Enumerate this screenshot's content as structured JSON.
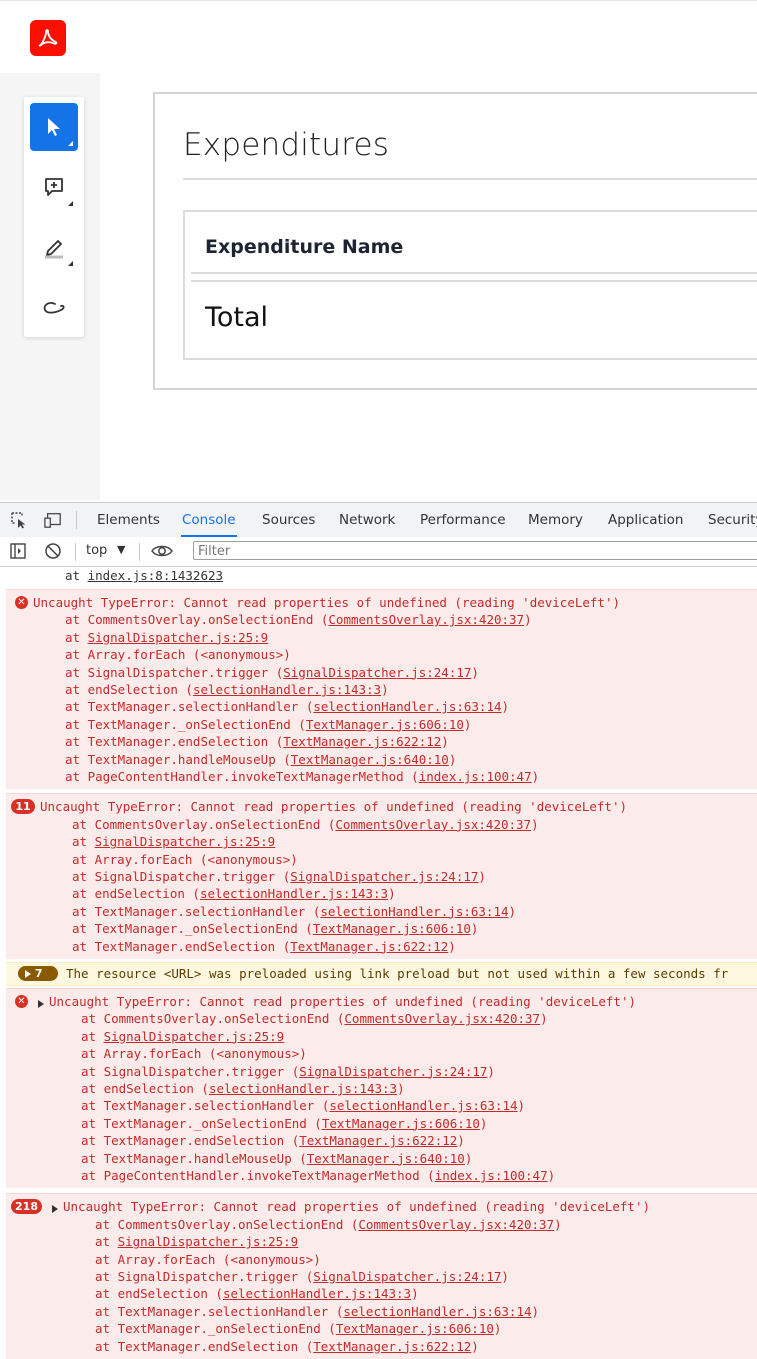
{
  "doc": {
    "title": "Expenditures",
    "table_header": "Expenditure Name",
    "row_total": "Total"
  },
  "devtools": {
    "tabs": [
      "Elements",
      "Console",
      "Sources",
      "Network",
      "Performance",
      "Memory",
      "Application",
      "Security"
    ],
    "active_tab": "Console",
    "context": "top",
    "filter_placeholder": "Filter"
  },
  "console": {
    "first_line": {
      "prefix": "at ",
      "link": "index.js:8:1432623"
    },
    "error_message": "Uncaught TypeError: Cannot read properties of undefined (reading 'deviceLeft')",
    "warning_count": "7",
    "warning_message": "The resource <URL> was preloaded using link preload but not used within a few seconds fr",
    "groups": [
      {
        "badge": "",
        "expandable": false,
        "stack": [
          {
            "fn": "CommentsOverlay.onSelectionEnd",
            "loc": "CommentsOverlay.jsx:420:37",
            "paren": true
          },
          {
            "fn": "",
            "loc": "SignalDispatcher.js:25:9",
            "paren": false
          },
          {
            "fn": "Array.forEach",
            "loc": "<anonymous>",
            "paren": true,
            "plain": true
          },
          {
            "fn": "SignalDispatcher.trigger",
            "loc": "SignalDispatcher.js:24:17",
            "paren": true
          },
          {
            "fn": "endSelection",
            "loc": "selectionHandler.js:143:3",
            "paren": true
          },
          {
            "fn": "TextManager.selectionHandler",
            "loc": "selectionHandler.js:63:14",
            "paren": true
          },
          {
            "fn": "TextManager._onSelectionEnd",
            "loc": "TextManager.js:606:10",
            "paren": true
          },
          {
            "fn": "TextManager.endSelection",
            "loc": "TextManager.js:622:12",
            "paren": true
          },
          {
            "fn": "TextManager.handleMouseUp",
            "loc": "TextManager.js:640:10",
            "paren": true
          },
          {
            "fn": "PageContentHandler.invokeTextManagerMethod",
            "loc": "index.js:100:47",
            "paren": true
          }
        ]
      },
      {
        "badge": "11",
        "expandable": false,
        "stack": [
          {
            "fn": "CommentsOverlay.onSelectionEnd",
            "loc": "CommentsOverlay.jsx:420:37",
            "paren": true
          },
          {
            "fn": "",
            "loc": "SignalDispatcher.js:25:9",
            "paren": false
          },
          {
            "fn": "Array.forEach",
            "loc": "<anonymous>",
            "paren": true,
            "plain": true
          },
          {
            "fn": "SignalDispatcher.trigger",
            "loc": "SignalDispatcher.js:24:17",
            "paren": true
          },
          {
            "fn": "endSelection",
            "loc": "selectionHandler.js:143:3",
            "paren": true
          },
          {
            "fn": "TextManager.selectionHandler",
            "loc": "selectionHandler.js:63:14",
            "paren": true
          },
          {
            "fn": "TextManager._onSelectionEnd",
            "loc": "TextManager.js:606:10",
            "paren": true
          },
          {
            "fn": "TextManager.endSelection",
            "loc": "TextManager.js:622:12",
            "paren": true
          }
        ]
      },
      {
        "badge": "",
        "expandable": true,
        "stack": [
          {
            "fn": "CommentsOverlay.onSelectionEnd",
            "loc": "CommentsOverlay.jsx:420:37",
            "paren": true
          },
          {
            "fn": "",
            "loc": "SignalDispatcher.js:25:9",
            "paren": false
          },
          {
            "fn": "Array.forEach",
            "loc": "<anonymous>",
            "paren": true,
            "plain": true
          },
          {
            "fn": "SignalDispatcher.trigger",
            "loc": "SignalDispatcher.js:24:17",
            "paren": true
          },
          {
            "fn": "endSelection",
            "loc": "selectionHandler.js:143:3",
            "paren": true
          },
          {
            "fn": "TextManager.selectionHandler",
            "loc": "selectionHandler.js:63:14",
            "paren": true
          },
          {
            "fn": "TextManager._onSelectionEnd",
            "loc": "TextManager.js:606:10",
            "paren": true
          },
          {
            "fn": "TextManager.endSelection",
            "loc": "TextManager.js:622:12",
            "paren": true
          },
          {
            "fn": "TextManager.handleMouseUp",
            "loc": "TextManager.js:640:10",
            "paren": true
          },
          {
            "fn": "PageContentHandler.invokeTextManagerMethod",
            "loc": "index.js:100:47",
            "paren": true
          }
        ]
      },
      {
        "badge": "218",
        "expandable": true,
        "stack": [
          {
            "fn": "CommentsOverlay.onSelectionEnd",
            "loc": "CommentsOverlay.jsx:420:37",
            "paren": true
          },
          {
            "fn": "",
            "loc": "SignalDispatcher.js:25:9",
            "paren": false
          },
          {
            "fn": "Array.forEach",
            "loc": "<anonymous>",
            "paren": true,
            "plain": true
          },
          {
            "fn": "SignalDispatcher.trigger",
            "loc": "SignalDispatcher.js:24:17",
            "paren": true
          },
          {
            "fn": "endSelection",
            "loc": "selectionHandler.js:143:3",
            "paren": true
          },
          {
            "fn": "TextManager.selectionHandler",
            "loc": "selectionHandler.js:63:14",
            "paren": true
          },
          {
            "fn": "TextManager._onSelectionEnd",
            "loc": "TextManager.js:606:10",
            "paren": true
          },
          {
            "fn": "TextManager.endSelection",
            "loc": "TextManager.js:622:12",
            "paren": true
          }
        ]
      }
    ]
  }
}
